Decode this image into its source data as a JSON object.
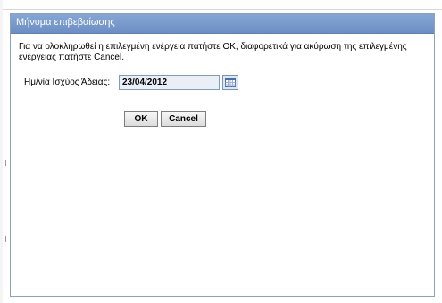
{
  "dialog": {
    "title": "Μήνυμα επιβεβαίωσης",
    "message": "Για να ολοκληρωθεί η επιλεγμένη ενέργεια πατήστε OK, διαφορετικά για ακύρωση της επιλεγμένης ενέργειας πατήστε Cancel.",
    "field_label": "Ημ/νία Ισχύος Άδειας:",
    "date_value": "23/04/2012",
    "ok_label": "OK",
    "cancel_label": "Cancel"
  },
  "icons": {
    "calendar_button": "calendar-icon"
  },
  "colors": {
    "titlebar": "#7898ca",
    "title_text": "#ffffff",
    "input_background": "#e9eef7"
  }
}
